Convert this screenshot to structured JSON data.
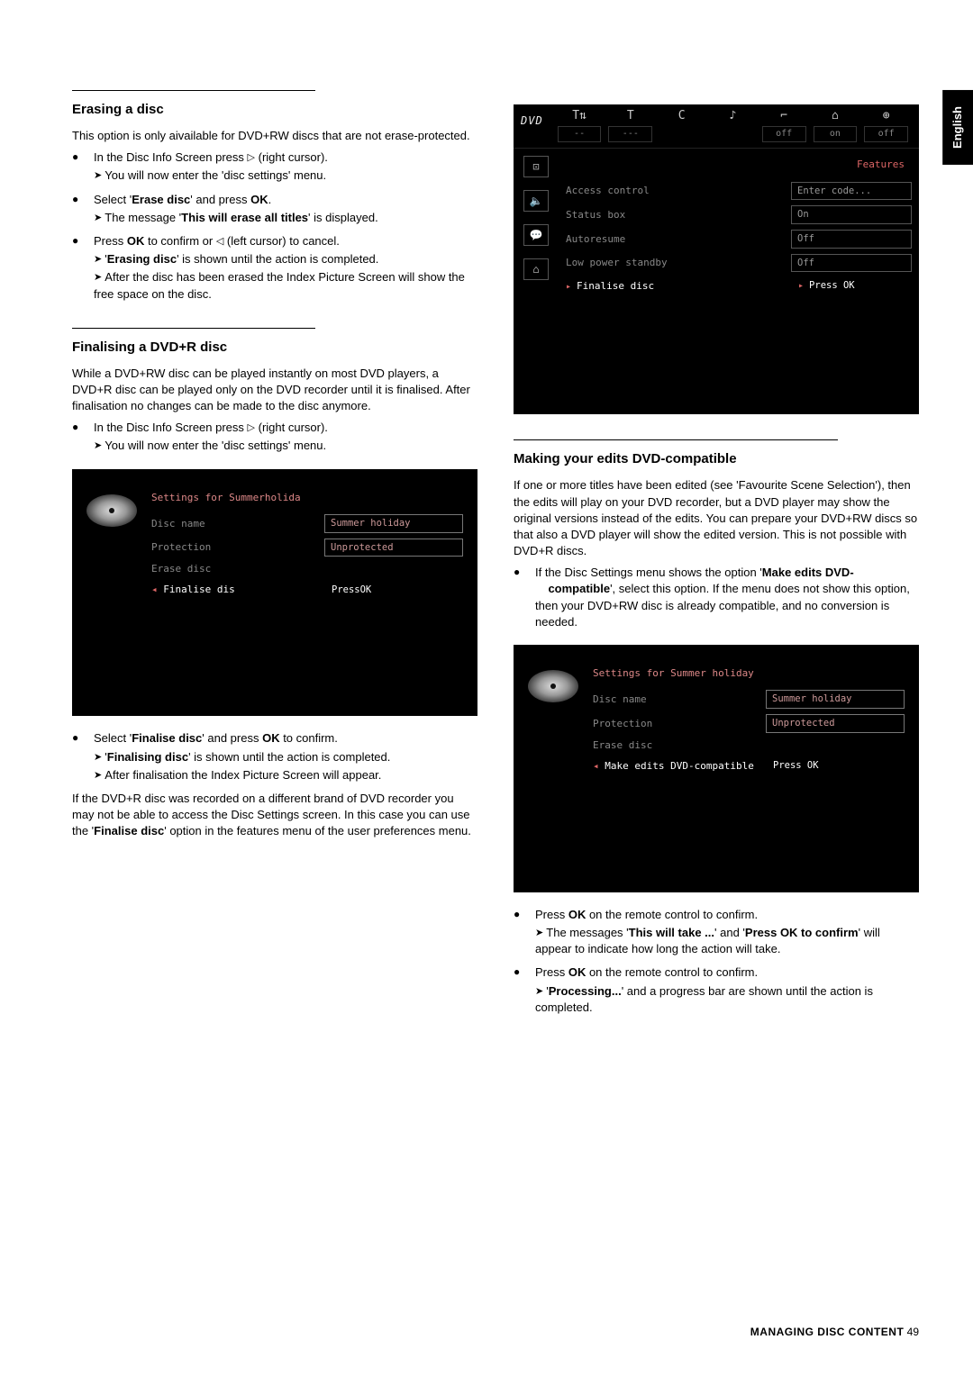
{
  "lang_tab": "English",
  "left": {
    "sec1_title": "Erasing a disc",
    "sec1_intro": "This option is only aivailable for DVD+RW discs that are not erase-protected.",
    "sec1_b1_text": "In the Disc Info Screen press ",
    "sec1_b1_text2": " (right cursor).",
    "sec1_b1_sub": "You will now enter the 'disc settings' menu.",
    "sec1_b2_text": "Select '",
    "sec1_b2_em": "Erase disc",
    "sec1_b2_text2": "' and press ",
    "sec1_b2_ok": "OK",
    "sec1_b2_text3": ".",
    "sec1_b2_sub_a": "The message '",
    "sec1_b2_sub_em": "This will erase all titles",
    "sec1_b2_sub_b": "' is displayed.",
    "sec1_b3_text": "Press ",
    "sec1_b3_ok": "OK",
    "sec1_b3_text2": " to confirm or ",
    "sec1_b3_text3": " (left cursor) to cancel.",
    "sec1_b3_sub1_a": "'",
    "sec1_b3_sub1_em": "Erasing disc",
    "sec1_b3_sub1_b": "' is shown until the action is completed.",
    "sec1_b3_sub2": "After the disc has been erased the Index Picture Screen will show the free space on the disc.",
    "sec2_title": "Finalising a DVD+R disc",
    "sec2_intro": "While a DVD+RW disc can be played instantly on most DVD players, a DVD+R disc can be played only on the DVD recorder until it is finalised. After finalisation no changes can be made to the disc anymore.",
    "sec2_b1_text": "In the Disc Info Screen press ",
    "sec2_b1_text2": " (right cursor).",
    "sec2_b1_sub": "You will now enter the 'disc settings' menu.",
    "osd_a_title": "Settings for Summerholida",
    "osd_a_rows": [
      {
        "lbl": "Disc name",
        "val": "Summer holiday",
        "box": true
      },
      {
        "lbl": "Protection",
        "val": "Unprotected",
        "box": true
      },
      {
        "lbl": "Erase disc",
        "val": ""
      },
      {
        "lbl": "Finalise dis",
        "val": "PressOK",
        "sel": true
      }
    ],
    "sec2_b2_text": "Select '",
    "sec2_b2_em": "Finalise disc",
    "sec2_b2_text2": "' and press ",
    "sec2_b2_ok": "OK",
    "sec2_b2_text3": " to confirm.",
    "sec2_b2_sub1_a": "'",
    "sec2_b2_sub1_em": "Finalising disc",
    "sec2_b2_sub1_b": "' is shown until the action is completed.",
    "sec2_b2_sub2": "After finalisation the Index Picture Screen will appear.",
    "sec2_after_a": "If the DVD+R disc was recorded on a different brand of DVD recorder you may not be able to access the Disc Settings screen. In this case you can use the '",
    "sec2_after_em": "Finalise disc",
    "sec2_after_b": "' option in the features menu of the user preferences menu."
  },
  "right": {
    "osd_top_logo": "DVD",
    "osd_top_cells": [
      "T⇅",
      "T",
      "C",
      "♪",
      "⌐",
      "⌂",
      "⊕"
    ],
    "osd_top_vals": [
      "--",
      "---",
      "",
      "",
      "off",
      "on",
      "off"
    ],
    "osd_features": "Features",
    "osd_side_icons": [
      "⊡",
      "🔈",
      "💬",
      "⌂"
    ],
    "osd_rows": [
      {
        "lbl": "Access control",
        "val": "Enter code..."
      },
      {
        "lbl": "Status box",
        "val": "On"
      },
      {
        "lbl": "Autoresume",
        "val": "Off"
      },
      {
        "lbl": "Low power standby",
        "val": "Off"
      },
      {
        "lbl": "Finalise disc",
        "val": "Press OK",
        "sel": true
      }
    ],
    "sec3_title": "Making your edits DVD-compatible",
    "sec3_intro": "If one or more titles have been edited (see 'Favourite Scene Selection'), then the edits will play on your DVD recorder, but a DVD player may show the original versions instead of the edits. You can prepare your DVD+RW discs so that also a DVD player will show the edited version. This is not possible with DVD+R discs.",
    "sec3_b1_a": "If the Disc Settings menu shows the option '",
    "sec3_b1_em": "Make edits DVD-    compatible",
    "sec3_b1_b": "', select this option. If the menu does not show this option, then your DVD+RW disc is already compatible, and no conversion is needed.",
    "osd_b_title": "Settings for Summer holiday",
    "osd_b_rows": [
      {
        "lbl": "Disc name",
        "val": "Summer holiday",
        "box": true
      },
      {
        "lbl": "Protection",
        "val": "Unprotected",
        "box": true
      },
      {
        "lbl": "Erase disc",
        "val": ""
      },
      {
        "lbl": "Make edits DVD-compatible",
        "val": "Press OK",
        "sel": true
      }
    ],
    "sec3_b2_a": "Press ",
    "sec3_b2_ok": "OK",
    "sec3_b2_b": " on the remote control to confirm.",
    "sec3_b2_sub_a": "The messages '",
    "sec3_b2_sub_em1": "This will take ...",
    "sec3_b2_sub_b": "' and '",
    "sec3_b2_sub_em2": "Press OK to confirm",
    "sec3_b2_sub_c": "' will appear to indicate how long the action will take.",
    "sec3_b3_a": "Press ",
    "sec3_b3_ok": "OK",
    "sec3_b3_b": " on the remote control to confirm.",
    "sec3_b3_sub_a": "'",
    "sec3_b3_sub_em": "Processing...",
    "sec3_b3_sub_b": "' and a progress bar are shown until the action is completed."
  },
  "footer_chapter": "MANAGING DISC CONTENT",
  "footer_page": "49"
}
